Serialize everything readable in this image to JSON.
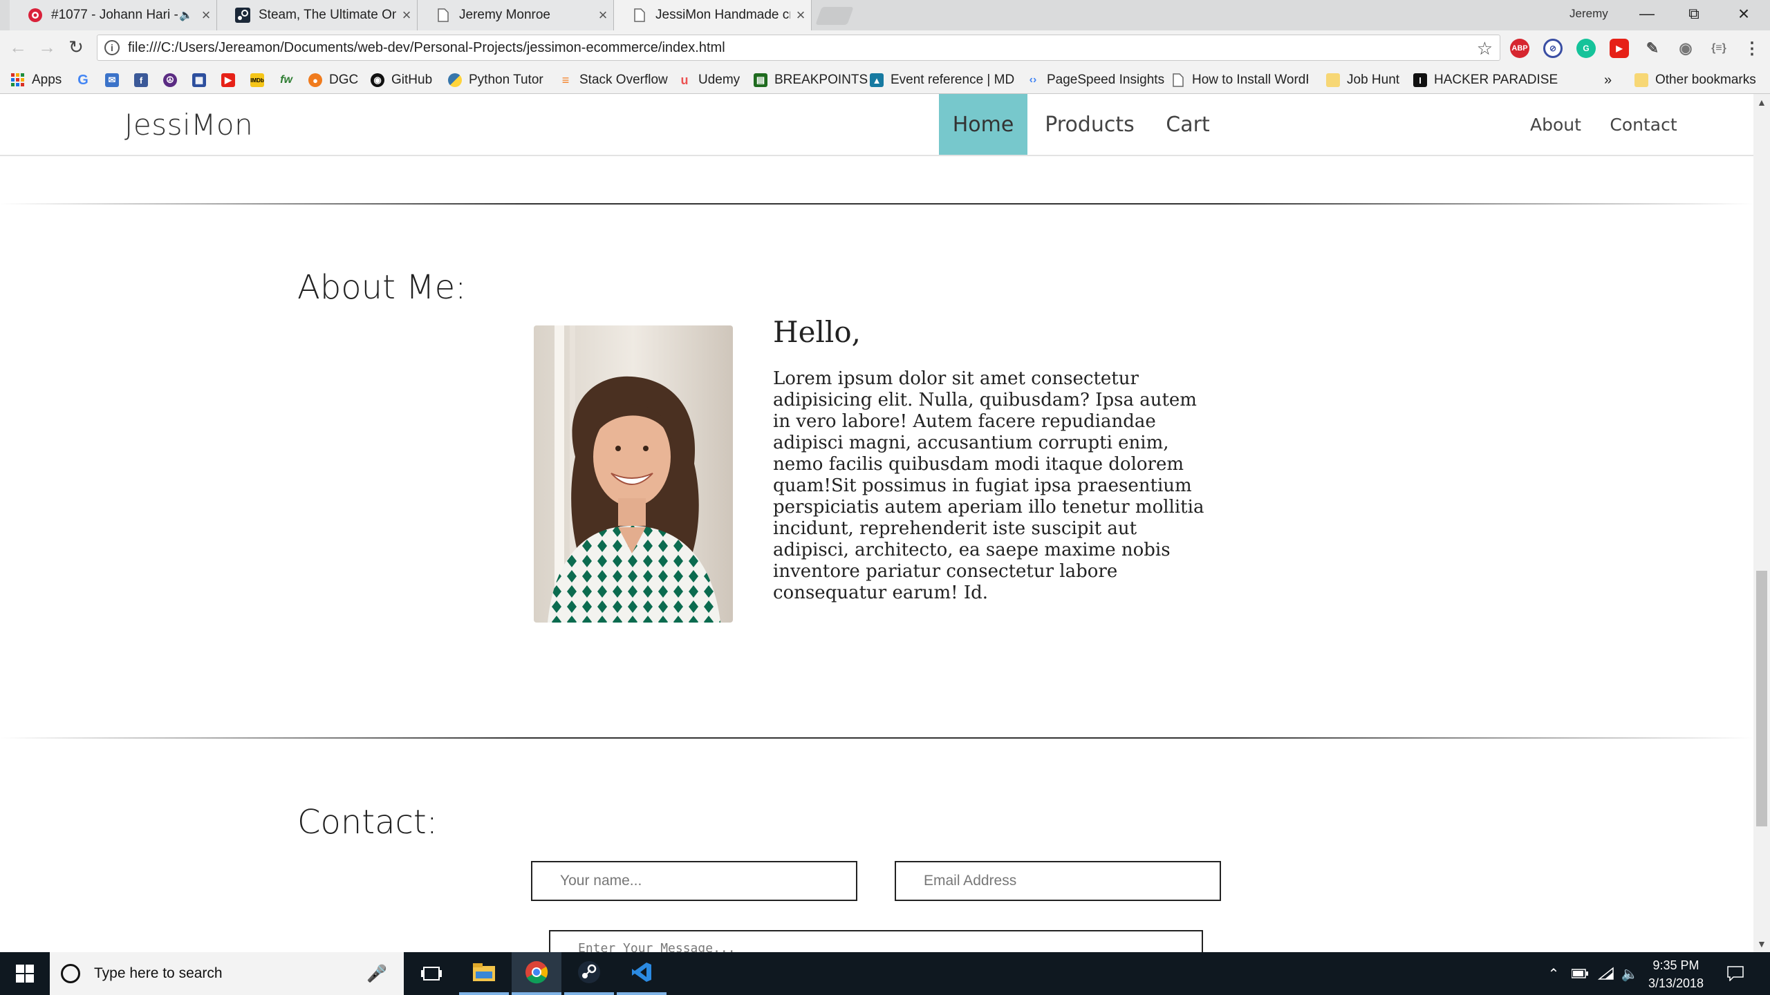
{
  "browser": {
    "tabs": [
      {
        "title": "#1077 - Johann Hari -",
        "favicon": "podcast-icon",
        "audio": true,
        "active": false
      },
      {
        "title": "Steam, The Ultimate Onli",
        "favicon": "steam-icon",
        "active": false
      },
      {
        "title": "Jeremy Monroe",
        "favicon": "page-icon",
        "active": false
      },
      {
        "title": "JessiMon Handmade cra",
        "favicon": "page-icon",
        "active": true
      }
    ],
    "profile_name": "Jeremy",
    "url": "file:///C:/Users/Jereamon/Documents/web-dev/Personal-Projects/jessimon-ecommerce/index.html",
    "extensions": [
      "adblock-icon",
      "block-icon",
      "grammarly-icon",
      "youtube-icon",
      "eyedropper-icon",
      "camera-icon",
      "json-icon"
    ],
    "bookmarks": [
      {
        "label": "Apps",
        "icon": "apps-grid-icon"
      },
      {
        "label": "",
        "icon": "google-icon"
      },
      {
        "label": "",
        "icon": "mail-icon"
      },
      {
        "label": "",
        "icon": "facebook-icon"
      },
      {
        "label": "",
        "icon": "peace-icon"
      },
      {
        "label": "",
        "icon": "calendar-icon"
      },
      {
        "label": "",
        "icon": "youtube-icon"
      },
      {
        "label": "",
        "icon": "imdb-icon"
      },
      {
        "label": "",
        "icon": "fw-icon"
      },
      {
        "label": "DGC",
        "icon": "dgc-icon"
      },
      {
        "label": "GitHub",
        "icon": "github-icon"
      },
      {
        "label": "Python Tutor",
        "icon": "python-icon"
      },
      {
        "label": "Stack Overflow",
        "icon": "stackoverflow-icon"
      },
      {
        "label": "Udemy",
        "icon": "udemy-icon"
      },
      {
        "label": "BREAKPOINTS",
        "icon": "breakpoints-icon"
      },
      {
        "label": "Event reference | MD",
        "icon": "mdn-icon"
      },
      {
        "label": "PageSpeed Insights",
        "icon": "pagespeed-icon"
      },
      {
        "label": "How to Install WordP",
        "icon": "page-icon"
      },
      {
        "label": "Job Hunt",
        "icon": "folder-icon"
      },
      {
        "label": "HACKER PARADISE",
        "icon": "hacker-icon"
      }
    ],
    "bookmarks_overflow": "»",
    "other_bookmarks": "Other bookmarks"
  },
  "site": {
    "brand": "JessiMon",
    "nav": [
      {
        "label": "Home",
        "active": true
      },
      {
        "label": "Products",
        "active": false
      },
      {
        "label": "Cart",
        "active": false
      }
    ],
    "nav_right": [
      "About",
      "Contact"
    ],
    "about": {
      "heading": "About Me:",
      "greeting": "Hello,",
      "bio": "Lorem ipsum dolor sit amet consectetur adipisicing elit. Nulla, quibusdam? Ipsa autem in vero labore! Autem facere repudiandae adipisci magni, accusantium corrupti enim, nemo facilis quibusdam modi itaque dolorem quam!Sit possimus in fugiat ipsa praesentium perspiciatis autem aperiam illo tenetur mollitia incidunt, reprehenderit iste suscipit aut adipisci, architecto, ea saepe maxime nobis inventore pariatur consectetur labore consequatur earum! Id."
    },
    "contact": {
      "heading": "Contact:",
      "name_placeholder": "Your name...",
      "email_placeholder": "Email Address",
      "message_placeholder": "Enter Your Message..."
    }
  },
  "taskbar": {
    "search_placeholder": "Type here to search",
    "apps": [
      "task-view-icon",
      "file-explorer-icon",
      "chrome-icon",
      "steam-icon",
      "vscode-icon"
    ],
    "time": "9:35 PM",
    "date": "3/13/2018"
  },
  "colors": {
    "nav_active_bg": "#77c8cc",
    "taskbar_bg": "#0f1820"
  }
}
